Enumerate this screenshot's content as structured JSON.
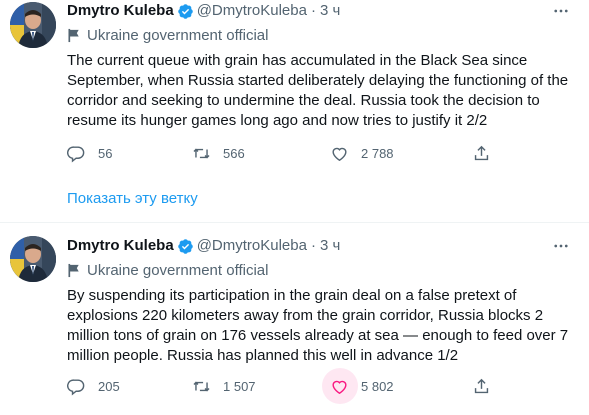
{
  "tweets": [
    {
      "author_name": "Dmytro Kuleba",
      "handle": "@DmytroKuleba",
      "separator": "·",
      "time": "3 ч",
      "affiliation": "Ukraine government official",
      "text": "The current queue with grain has accumulated in the Black Sea since September, when Russia started deliberately delaying the functioning of the corridor and seeking to undermine the deal. Russia took the decision to resume its hunger games long ago and now tries to justify it 2/2",
      "replies": "56",
      "retweets": "566",
      "likes": "2 788"
    },
    {
      "author_name": "Dmytro Kuleba",
      "handle": "@DmytroKuleba",
      "separator": "·",
      "time": "3 ч",
      "affiliation": "Ukraine government official",
      "text": "By suspending its participation in the grain deal on a false pretext of explosions 220 kilometers away from the grain corridor, Russia blocks 2 million tons of grain on 176 vessels already at sea — enough to feed over 7 million people. Russia has planned this well in advance 1/2",
      "replies": "205",
      "retweets": "1 507",
      "likes": "5 802"
    }
  ],
  "show_thread_label": "Показать эту ветку",
  "colors": {
    "verified": "#1d9bf0",
    "link": "#1d9bf0",
    "secondary_text": "#536471",
    "like_highlight": "#f91880"
  },
  "icons": [
    "verified-badge-icon",
    "more-icon",
    "flag-icon",
    "reply-icon",
    "retweet-icon",
    "like-icon",
    "share-icon"
  ]
}
